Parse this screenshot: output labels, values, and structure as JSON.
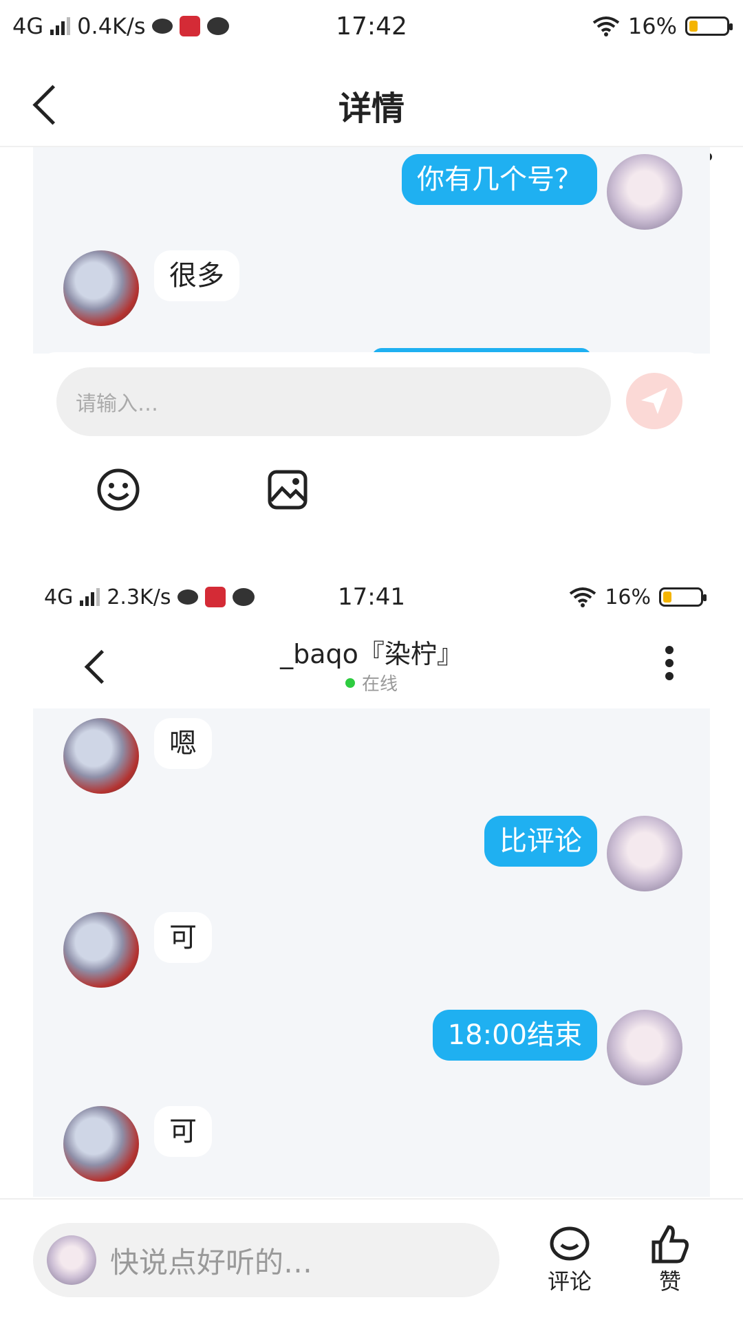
{
  "top_status": {
    "network": "4G",
    "speed": "0.4K/s",
    "time": "17:42",
    "battery": "16%"
  },
  "header": {
    "title": "详情"
  },
  "upper_chat": {
    "messages": [
      {
        "from": "me",
        "text": "你有几个号？"
      },
      {
        "from": "other",
        "text": "很多"
      }
    ]
  },
  "composer": {
    "placeholder": "请输入…"
  },
  "lower_status": {
    "network": "4G",
    "speed": "2.3K/s",
    "time": "17:41",
    "battery": "16%"
  },
  "chat_header": {
    "name": "_baqo『染柠』",
    "status": "在线",
    "status_color": "#2ecc40"
  },
  "lower_chat": {
    "messages": [
      {
        "from": "other",
        "text": "嗯"
      },
      {
        "from": "me",
        "text": "比评论"
      },
      {
        "from": "other",
        "text": "可"
      },
      {
        "from": "me",
        "text": "18:00结束"
      },
      {
        "from": "other",
        "text": "可"
      }
    ]
  },
  "bottom_bar": {
    "placeholder": "快说点好听的…",
    "comment_label": "评论",
    "like_label": "赞"
  },
  "colors": {
    "accent": "#1fb0f1",
    "panel": "#f4f6f9"
  }
}
